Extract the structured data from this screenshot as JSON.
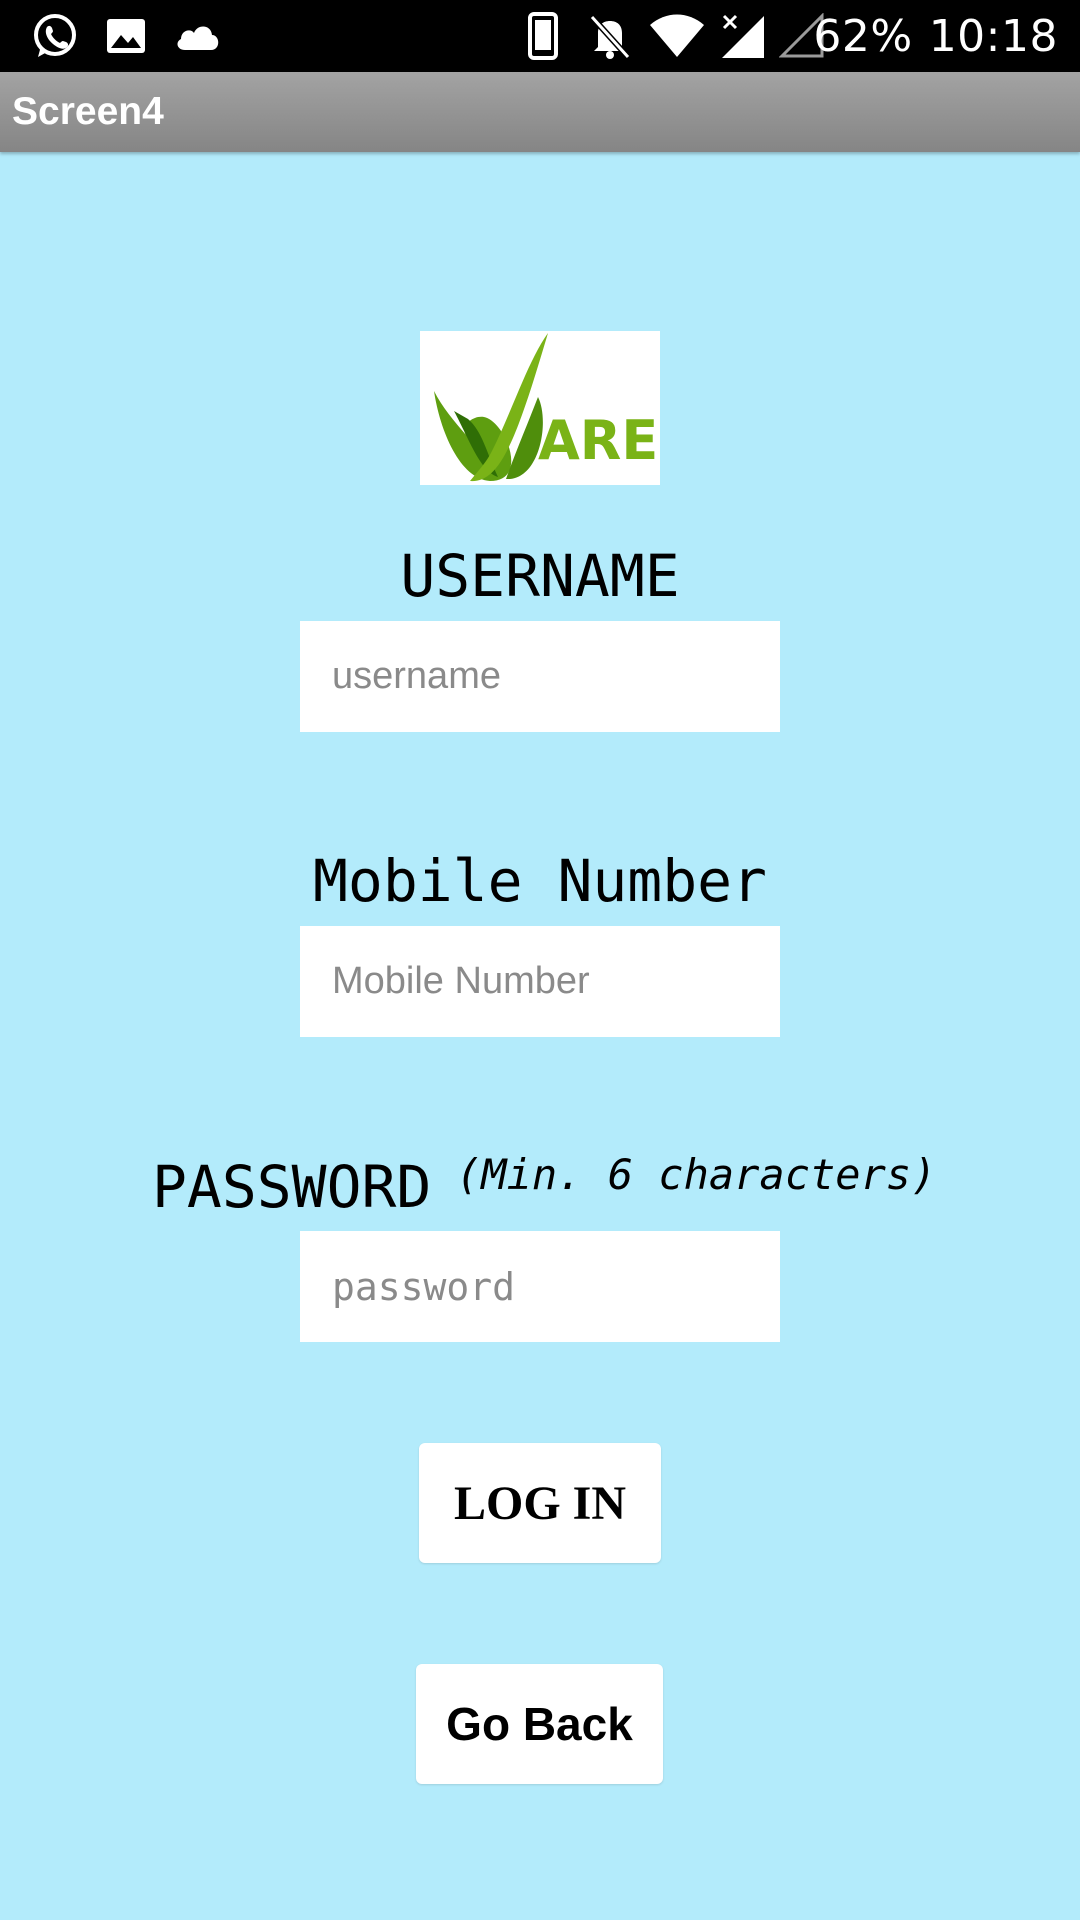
{
  "status_bar": {
    "battery": "62%",
    "time": "10:18",
    "icons": [
      "whatsapp-icon",
      "gallery-icon",
      "cloud-icon",
      "phone-icon",
      "bell-off-icon",
      "wifi-icon",
      "signal-icon",
      "signal-empty-icon"
    ]
  },
  "app": {
    "title": "Screen4"
  },
  "logo": {
    "text": "ARE"
  },
  "form": {
    "username_label": "USERNAME",
    "username_placeholder": "username",
    "mobile_label": "Mobile Number",
    "mobile_placeholder": "Mobile Number",
    "password_label": "PASSWORD",
    "password_hint": "(Min. 6 characters)",
    "password_placeholder": "password"
  },
  "buttons": {
    "login_label": "LOG IN",
    "back_label": "Go Back"
  },
  "colors": {
    "background": "#b3ebfb",
    "status_bar": "#000000",
    "title_bar": "#959595",
    "logo_green": "#7ab317"
  }
}
